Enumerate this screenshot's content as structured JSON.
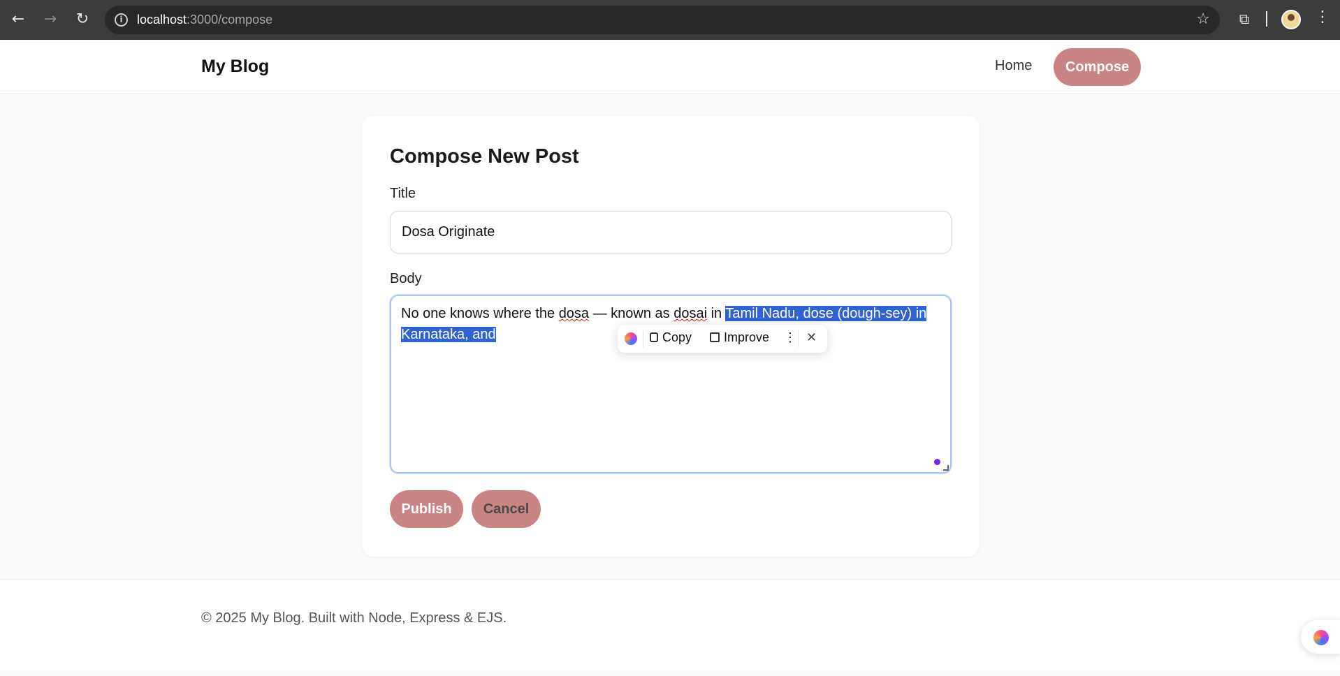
{
  "browser": {
    "url_host": "localhost",
    "url_path": ":3000/compose",
    "icons": {
      "back": "back-arrow-icon",
      "forward": "forward-arrow-icon",
      "reload": "reload-icon",
      "info": "site-info-icon",
      "bookmark": "star-icon",
      "extensions": "puzzle-icon",
      "menu": "kebab-menu-icon"
    }
  },
  "header": {
    "brand": "My Blog",
    "nav": {
      "home": "Home",
      "compose": "Compose"
    }
  },
  "form": {
    "heading": "Compose New Post",
    "title_label": "Title",
    "title_value": "Dosa Originate",
    "body_label": "Body",
    "body": {
      "before": "No one knows where the ",
      "word1": "dosa",
      "mid1": " — known as ",
      "word2": "dosai",
      "mid2": " in ",
      "selected_line1": "Tamil Nadu, dose (dough-sey) in ",
      "selected_line2": "Karnataka, and "
    },
    "publish_label": "Publish",
    "cancel_label": "Cancel"
  },
  "ai_toolbar": {
    "copy_label": "Copy",
    "improve_label": "Improve"
  },
  "footer": {
    "text": "© 2025 My Blog. Built with Node, Express & EJS."
  },
  "colors": {
    "accent": "#c98484",
    "selection": "#2f63d4",
    "focus_ring": "#a9c6f5"
  }
}
